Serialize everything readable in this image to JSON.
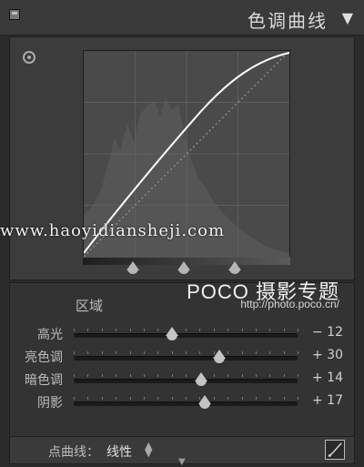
{
  "header": {
    "title": "色调曲线",
    "collapse_icon": "triangle-down-icon",
    "toggle_icon": "panel-toggle-icon"
  },
  "curve": {
    "target_icon": "target-adjust-icon",
    "handle_icon": "triangle-up-icon"
  },
  "watermark": {
    "text": "www.haoyidiansheji.com"
  },
  "region": {
    "label": "区域",
    "brand": "POCO 摄影专题",
    "brand_url": "http://photo.poco.cn/",
    "sliders": [
      {
        "label": "高光",
        "value_text": "− 12",
        "value": -12
      },
      {
        "label": "亮色调",
        "value_text": "+ 30",
        "value": 30
      },
      {
        "label": "暗色调",
        "value_text": "+ 14",
        "value": 14
      },
      {
        "label": "阴影",
        "value_text": "+ 17",
        "value": 17
      }
    ],
    "slider_range": [
      -100,
      100
    ]
  },
  "footer": {
    "point_curve_label": "点曲线：",
    "point_curve_value": "线性",
    "select_icon": "updown-arrows-icon",
    "curve_button_icon": "curve-edit-icon"
  },
  "colors": {
    "panel_bg": "#2b2b2b",
    "graph_bg": "#4a4a4a",
    "curve": "#ffffff"
  }
}
